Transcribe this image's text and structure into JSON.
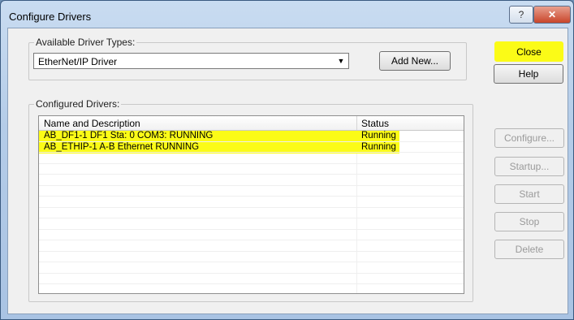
{
  "window": {
    "title": "Configure Drivers"
  },
  "titlebar": {
    "help_glyph": "?",
    "close_glyph": "✕"
  },
  "available": {
    "group_label": "Available Driver Types:",
    "selected": "EtherNet/IP Driver",
    "add_new_label": "Add New..."
  },
  "configured": {
    "group_label": "Configured Drivers:",
    "columns": [
      "Name and Description",
      "Status"
    ],
    "rows": [
      {
        "name": "AB_DF1-1 DF1 Sta: 0 COM3: RUNNING",
        "status": "Running"
      },
      {
        "name": "AB_ETHIP-1  A-B Ethernet  RUNNING",
        "status": "Running"
      }
    ]
  },
  "buttons": {
    "close": "Close",
    "help": "Help",
    "configure": "Configure...",
    "startup": "Startup...",
    "start": "Start",
    "stop": "Stop",
    "delete": "Delete"
  },
  "colors": {
    "highlight": "#fbfb17"
  }
}
